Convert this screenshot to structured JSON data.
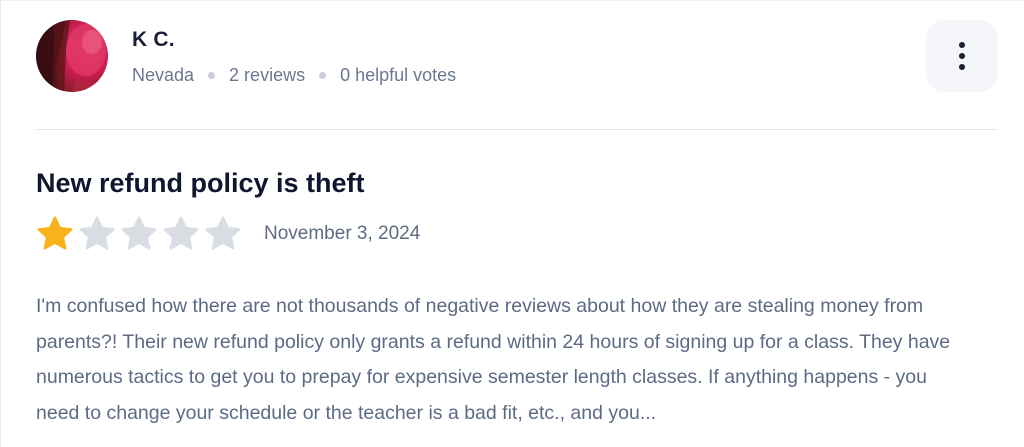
{
  "reviewer": {
    "name": "K C.",
    "location": "Nevada",
    "reviews_count": "2 reviews",
    "helpful_votes": "0 helpful votes"
  },
  "review": {
    "title": "New refund policy is theft",
    "rating": 1,
    "max_rating": 5,
    "date": "November 3, 2024",
    "body": "I'm confused how there are not thousands of negative reviews about how they are stealing money from parents?! Their new refund policy only grants a refund within 24 hours of signing up for a class. They have numerous tactics to get you to prepay for expensive semester length classes. If anything happens - you need to change your schedule or the teacher is a bad fit, etc., and you..."
  },
  "icons": {
    "more": "vertical-ellipsis-icon",
    "star_filled": "star-filled-icon",
    "star_empty": "star-empty-icon"
  },
  "colors": {
    "star_filled": "#f7b31b",
    "star_empty": "#d9dde4",
    "text_muted": "#5c6a86",
    "title": "#10162f"
  }
}
